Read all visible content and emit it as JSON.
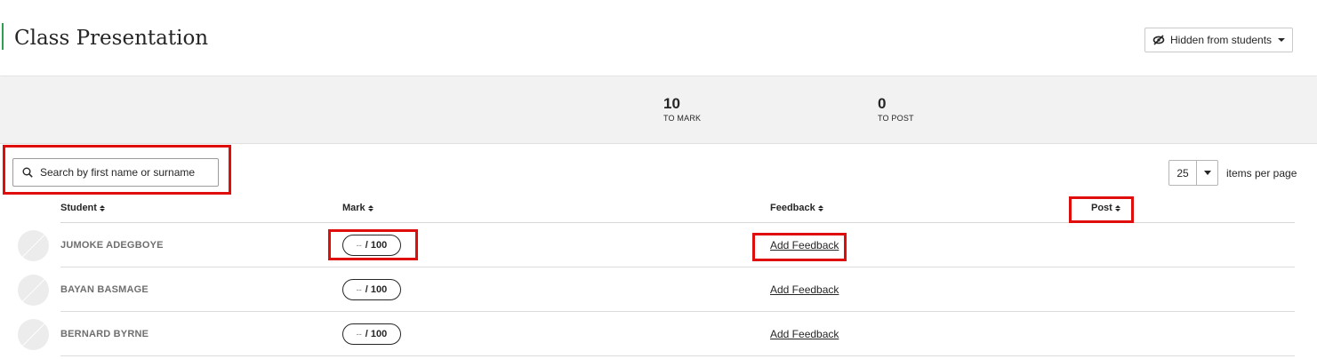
{
  "header": {
    "title": "Class Presentation",
    "visibility_label": "Hidden from students",
    "visibility_icon": "eye-slash-icon"
  },
  "stats": {
    "to_mark": {
      "value": "10",
      "label": "TO MARK"
    },
    "to_post": {
      "value": "0",
      "label": "TO POST"
    }
  },
  "search": {
    "placeholder": "Search by first name or surname",
    "value": ""
  },
  "pagination": {
    "per_page_value": "25",
    "per_page_label": "items per page"
  },
  "columns": {
    "student": "Student",
    "mark": "Mark",
    "feedback": "Feedback",
    "post": "Post"
  },
  "rows": [
    {
      "name": "JUMOKE ADEGBOYE",
      "mark_value": "--",
      "mark_total": "/ 100",
      "feedback_label": "Add Feedback"
    },
    {
      "name": "BAYAN BASMAGE",
      "mark_value": "--",
      "mark_total": "/ 100",
      "feedback_label": "Add Feedback"
    },
    {
      "name": "BERNARD BYRNE",
      "mark_value": "--",
      "mark_total": "/ 100",
      "feedback_label": "Add Feedback"
    }
  ],
  "colors": {
    "accent_green": "#2e9e4f",
    "highlight_red": "#e00d0d",
    "stats_background": "#f2f2f2"
  }
}
